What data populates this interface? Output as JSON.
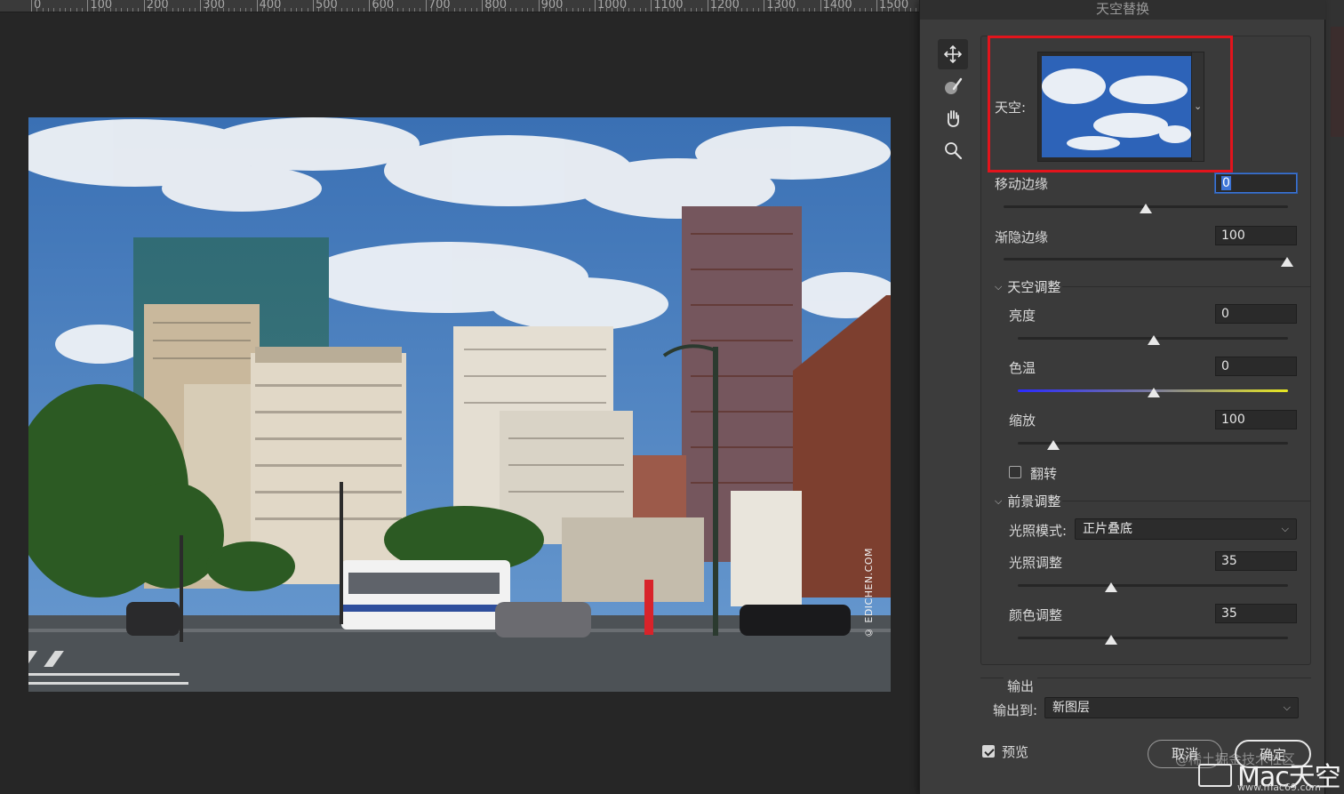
{
  "ruler": {
    "labels": [
      "0",
      "100",
      "200",
      "300",
      "400",
      "500",
      "600",
      "700",
      "800",
      "900",
      "1000",
      "1100",
      "1200",
      "1300",
      "1400",
      "1500"
    ]
  },
  "canvas": {
    "watermark": "© EDICHEN.COM"
  },
  "dialog": {
    "title": "天空替换",
    "tools": [
      "move-icon",
      "sky-brush-icon",
      "hand-icon",
      "zoom-icon"
    ],
    "sky": {
      "label": "天空:"
    },
    "shift_edge": {
      "label": "移动边缘",
      "value": "0"
    },
    "fade_edge": {
      "label": "渐隐边缘",
      "value": "100"
    },
    "sky_adjustments": {
      "header": "天空调整",
      "brightness": {
        "label": "亮度",
        "value": "0"
      },
      "temperature": {
        "label": "色温",
        "value": "0"
      },
      "scale": {
        "label": "缩放",
        "value": "100"
      },
      "flip": {
        "label": "翻转",
        "checked": false
      }
    },
    "foreground_adjustments": {
      "header": "前景调整",
      "lighting_mode": {
        "label": "光照模式:",
        "value": "正片叠底"
      },
      "lighting_adjust": {
        "label": "光照调整",
        "value": "35"
      },
      "color_adjust": {
        "label": "颜色调整",
        "value": "35"
      }
    },
    "output": {
      "header": "输出",
      "label": "输出到:",
      "value": "新图层"
    },
    "preview": {
      "label": "预览",
      "checked": true
    },
    "cancel_label": "取消",
    "ok_label": "确定"
  },
  "colors": {
    "highlight": "#e2141c",
    "focus": "#3d74d6"
  },
  "overlay": {
    "watermark_text": "@稀土掘金技术社区",
    "logo_text": "Mac天空",
    "logo_url": "www.mac69.com"
  }
}
